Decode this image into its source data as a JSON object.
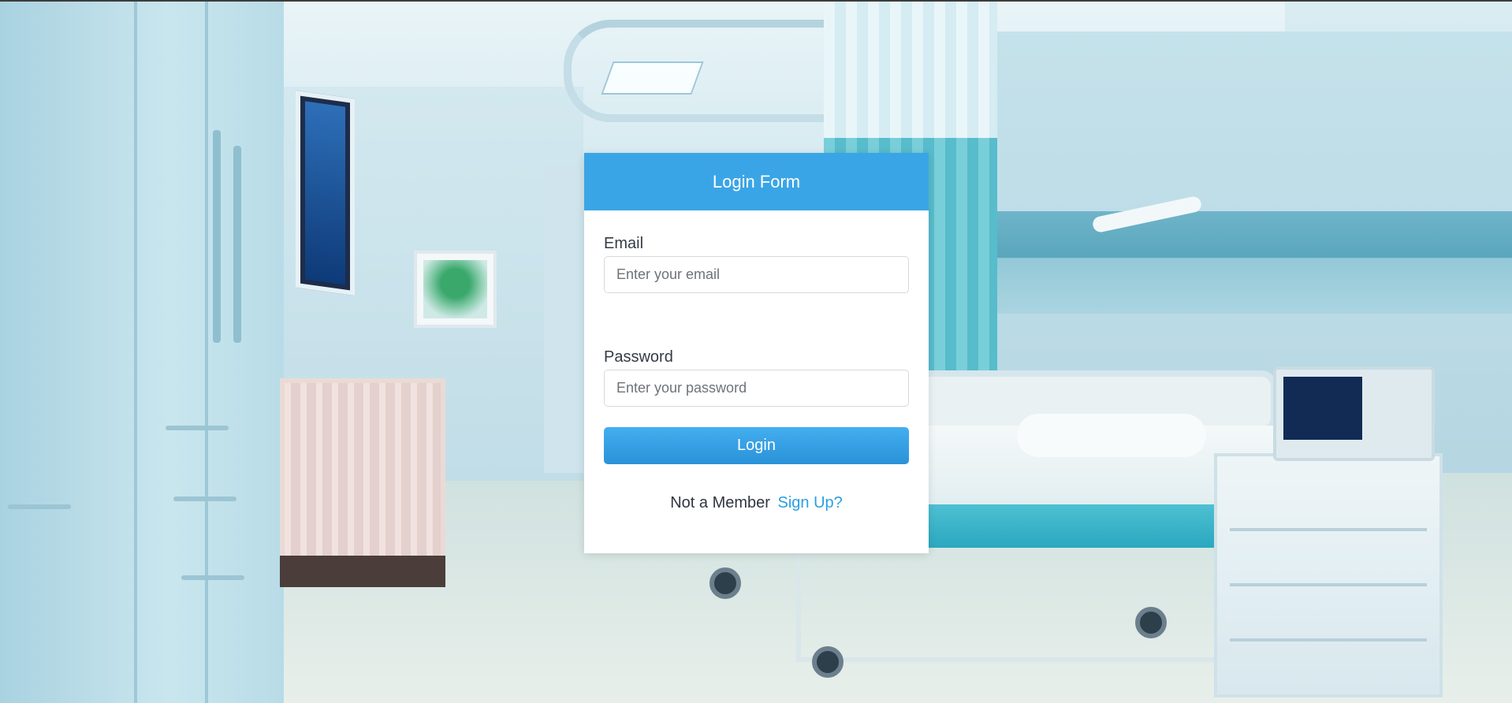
{
  "colors": {
    "header_bg": "#3aa5e6",
    "button_bg": "#3aa5e6",
    "link": "#2a9fe0",
    "card_bg": "#ffffff"
  },
  "background": {
    "image": "hospital-room-scene"
  },
  "login_form": {
    "title": "Login Form",
    "email": {
      "label": "Email",
      "placeholder": "Enter your email",
      "value": ""
    },
    "password": {
      "label": "Password",
      "placeholder": "Enter your password",
      "value": ""
    },
    "submit_label": "Login",
    "signup_prompt": "Not a Member",
    "signup_link": "Sign Up?"
  }
}
